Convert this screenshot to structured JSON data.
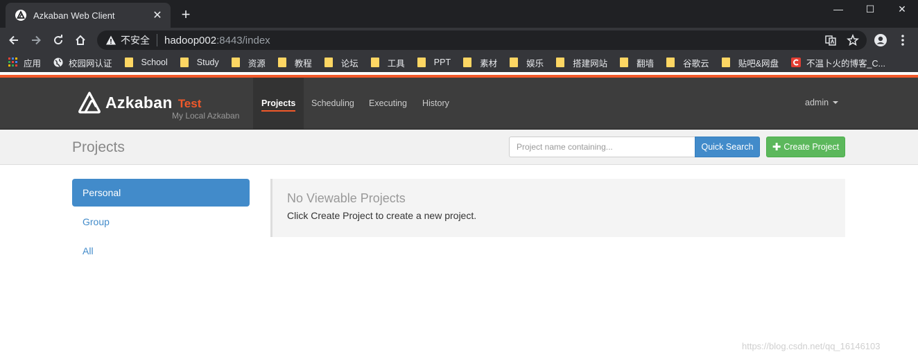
{
  "browser": {
    "tab_title": "Azkaban Web Client",
    "tab_close": "✕",
    "new_tab": "+",
    "window_controls": {
      "minimize": "—",
      "maximize": "☐",
      "close": "✕"
    },
    "security_label": "不安全",
    "url_host": "hadoop002",
    "url_path": ":8443/index",
    "bookmarks": [
      {
        "label": "应用",
        "icon": "apps-grid-icon"
      },
      {
        "label": "校园网认证",
        "icon": "globe-icon"
      },
      {
        "label": "School",
        "icon": "folder-icon"
      },
      {
        "label": "Study",
        "icon": "folder-icon"
      },
      {
        "label": "资源",
        "icon": "folder-icon"
      },
      {
        "label": "教程",
        "icon": "folder-icon"
      },
      {
        "label": "论坛",
        "icon": "folder-icon"
      },
      {
        "label": "工具",
        "icon": "folder-icon"
      },
      {
        "label": "PPT",
        "icon": "folder-icon"
      },
      {
        "label": "素材",
        "icon": "folder-icon"
      },
      {
        "label": "娱乐",
        "icon": "folder-icon"
      },
      {
        "label": "搭建网站",
        "icon": "folder-icon"
      },
      {
        "label": "翻墙",
        "icon": "folder-icon"
      },
      {
        "label": "谷歌云",
        "icon": "folder-icon"
      },
      {
        "label": "贴吧&网盘",
        "icon": "folder-icon"
      },
      {
        "label": "不温卜火的博客_C...",
        "icon": "csdn-icon"
      }
    ]
  },
  "app": {
    "brand_name": "Azkaban",
    "brand_env": "Test",
    "brand_subtitle": "My Local Azkaban",
    "nav": {
      "projects": "Projects",
      "scheduling": "Scheduling",
      "executing": "Executing",
      "history": "History"
    },
    "user": "admin",
    "accent_color": "#f1592a"
  },
  "header": {
    "title": "Projects",
    "search_placeholder": "Project name containing...",
    "quick_search": "Quick Search",
    "create_plus": "✚",
    "create_project": "Create Project"
  },
  "sidebar": {
    "items": [
      {
        "label": "Personal",
        "active": true
      },
      {
        "label": "Group",
        "active": false
      },
      {
        "label": "All",
        "active": false
      }
    ]
  },
  "main": {
    "empty_title": "No Viewable Projects",
    "empty_text": "Click Create Project to create a new project."
  },
  "watermark": "https://blog.csdn.net/qq_16146103"
}
